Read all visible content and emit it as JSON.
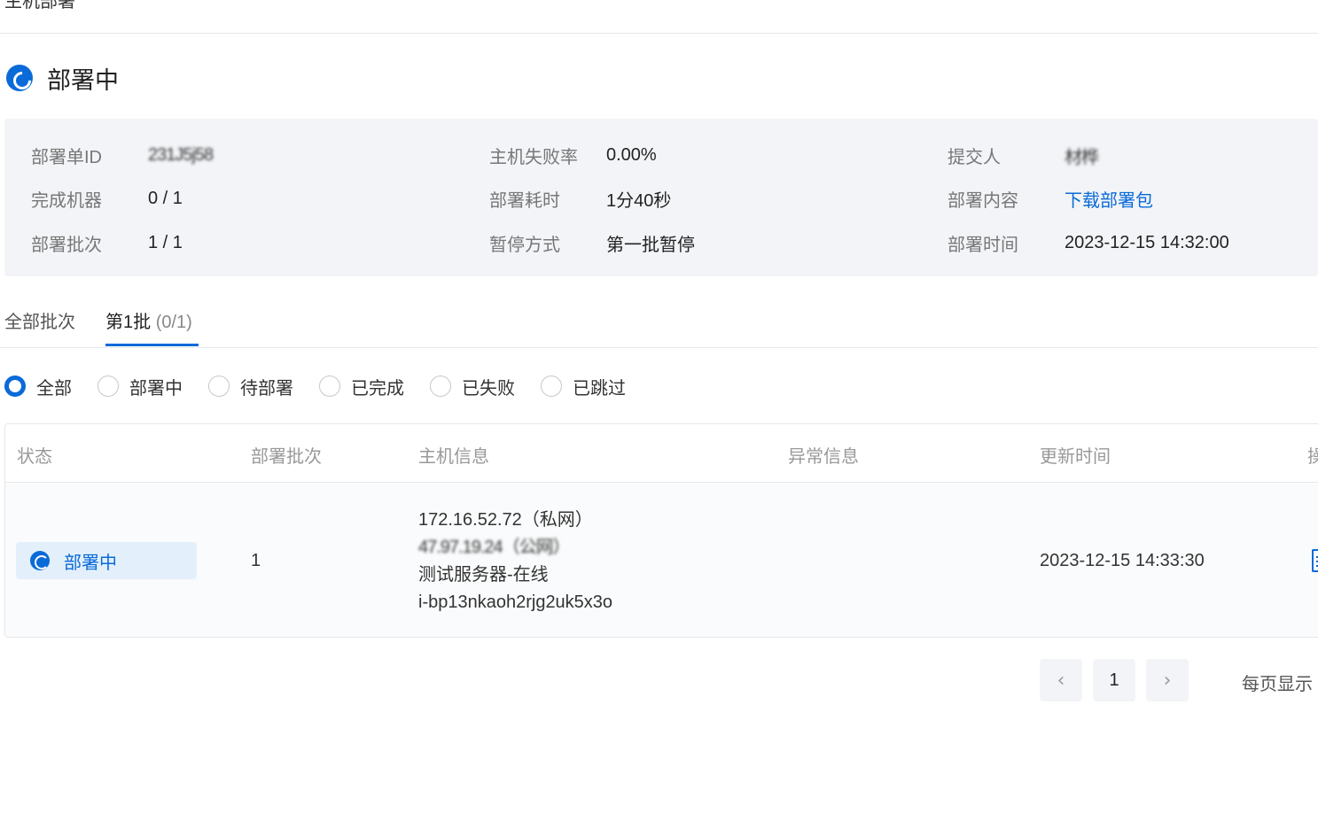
{
  "page": {
    "title": "主机部署",
    "status": "部署中"
  },
  "info": {
    "deploy_id_label": "部署单ID",
    "deploy_id_value": "231J5j58",
    "done_label": "完成机器",
    "done_value": "0 / 1",
    "batch_label": "部署批次",
    "batch_value": "1 / 1",
    "fail_rate_label": "主机失败率",
    "fail_rate_value": "0.00%",
    "duration_label": "部署耗时",
    "duration_value": "1分40秒",
    "pause_label": "暂停方式",
    "pause_value": "第一批暂停",
    "submitter_label": "提交人",
    "submitter_value": "材桦",
    "content_label": "部署内容",
    "content_link": "下载部署包",
    "time_label": "部署时间",
    "time_value": "2023-12-15 14:32:00"
  },
  "tabs": {
    "all": "全部批次",
    "batch1": "第1批",
    "batch1_count": "(0/1)"
  },
  "filters": {
    "all": "全部",
    "deploying": "部署中",
    "pending": "待部署",
    "completed": "已完成",
    "failed": "已失败",
    "skipped": "已跳过",
    "selected": "全部"
  },
  "table": {
    "headers": {
      "status": "状态",
      "batch": "部署批次",
      "host": "主机信息",
      "error": "异常信息",
      "updated": "更新时间",
      "action": "操"
    },
    "rows": [
      {
        "status": "部署中",
        "batch": "1",
        "private_ip": "172.16.52.72（私网）",
        "public_ip": "47.97.19.24（公网）",
        "host_name": "测试服务器-在线",
        "instance_id": "i-bp13nkaoh2rjg2uk5x3o",
        "error": "",
        "updated": "2023-12-15 14:33:30"
      }
    ]
  },
  "pager": {
    "current": "1",
    "per_page_label": "每页显示"
  }
}
